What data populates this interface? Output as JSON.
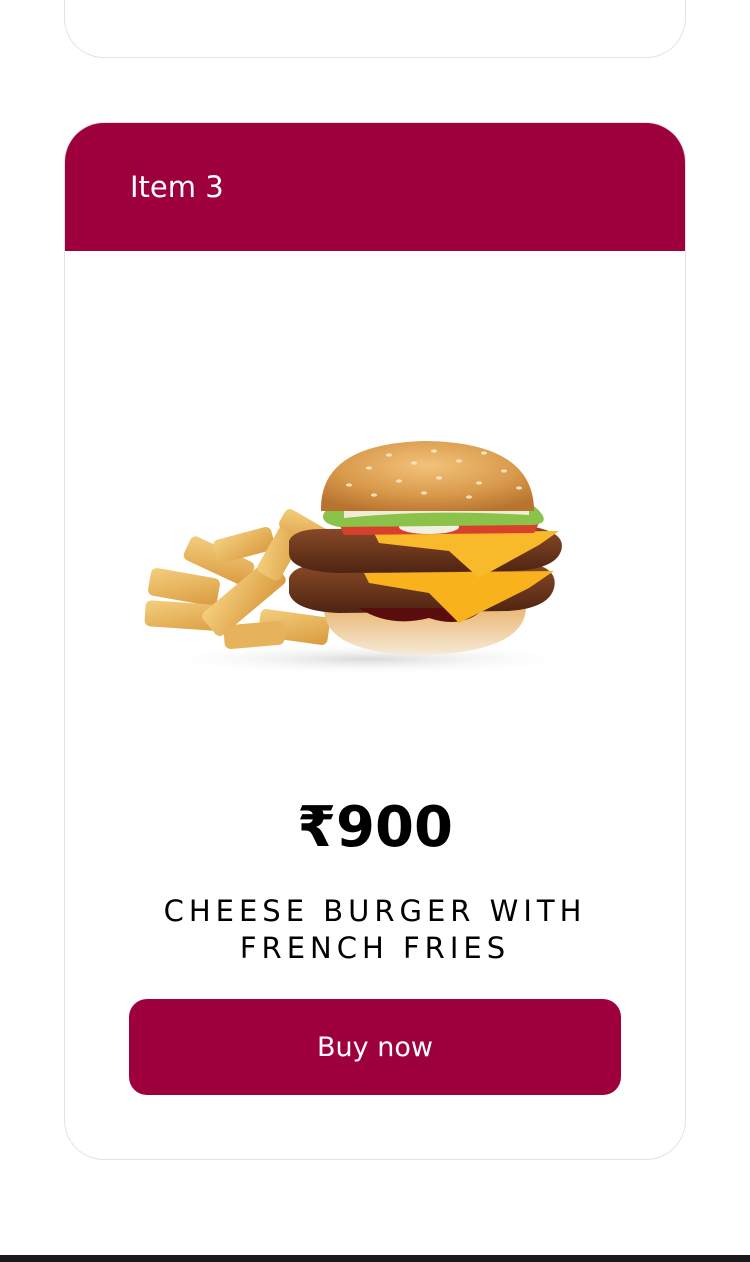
{
  "card": {
    "title": "Item 3",
    "price": "₹900",
    "name": "CHEESE BURGER WITH FRENCH FRIES",
    "button_label": "Buy now"
  },
  "image": {
    "icon": "burger-with-fries-image"
  },
  "colors": {
    "accent": "#9e003e",
    "card_border": "#e3e3e3",
    "text": "#000000"
  }
}
